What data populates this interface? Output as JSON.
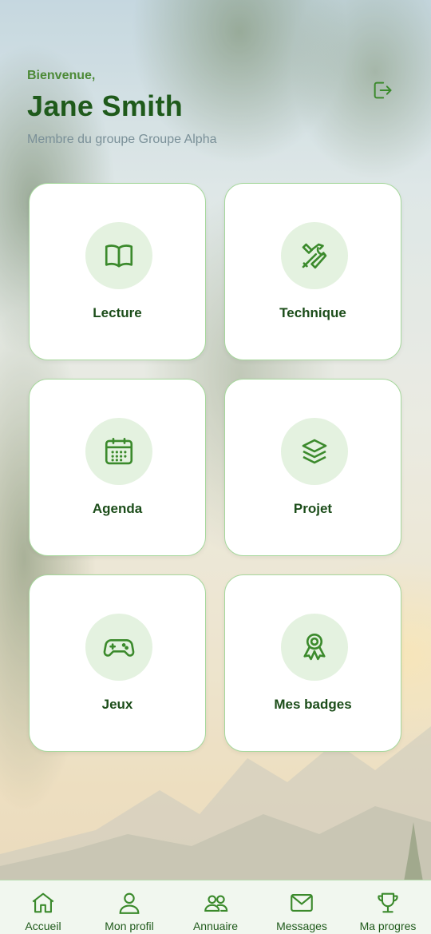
{
  "header": {
    "welcome": "Bienvenue,",
    "username": "Jane Smith",
    "group_text": "Membre du groupe Groupe Alpha",
    "logout_icon": "logout-icon"
  },
  "cards": [
    {
      "label": "Lecture",
      "icon": "book-icon"
    },
    {
      "label": "Technique",
      "icon": "tools-icon"
    },
    {
      "label": "Agenda",
      "icon": "calendar-icon"
    },
    {
      "label": "Projet",
      "icon": "layers-icon"
    },
    {
      "label": "Jeux",
      "icon": "gamepad-icon"
    },
    {
      "label": "Mes badges",
      "icon": "badge-icon"
    }
  ],
  "nav": [
    {
      "label": "Accueil",
      "icon": "home-icon"
    },
    {
      "label": "Mon profil",
      "icon": "user-icon"
    },
    {
      "label": "Annuaire",
      "icon": "users-icon"
    },
    {
      "label": "Messages",
      "icon": "mail-icon"
    },
    {
      "label": "Ma progres",
      "icon": "trophy-icon"
    }
  ],
  "colors": {
    "primary": "#1f5a1b",
    "accent": "#4d8a37",
    "icon": "#3b8a2c",
    "card_border": "#a6d89c",
    "icon_circle": "#e4f2e0",
    "navbar_bg": "#f1f7ef"
  }
}
